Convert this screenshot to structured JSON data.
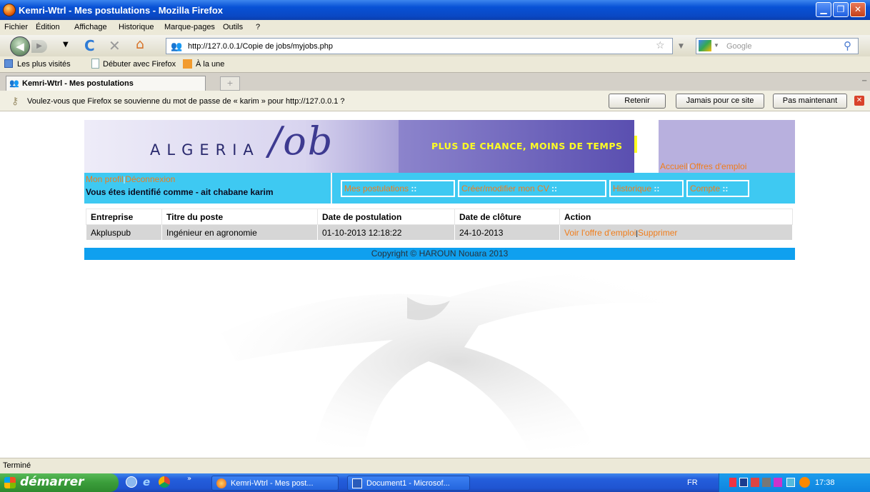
{
  "window": {
    "title": "Kemri-Wtrl - Mes postulations - Mozilla Firefox",
    "icon": "firefox-icon"
  },
  "menu": [
    "Fichier",
    "Édition",
    "Affichage",
    "Historique",
    "Marque-pages",
    "Outils",
    "?"
  ],
  "nav": {
    "url": "http://127.0.0.1/Copie de jobs/myjobs.php",
    "search_placeholder": "Google"
  },
  "bookmarks": [
    "Les plus visités",
    "Débuter avec Firefox",
    "À la une"
  ],
  "tab": {
    "label": "Kemri-Wtrl - Mes postulations",
    "new_tab": "+"
  },
  "notification": {
    "message": "Voulez-vous que Firefox se souvienne du mot de passe de « karim » pour http://127.0.0.1 ?",
    "buttons": [
      "Retenir",
      "Jamais pour ce site",
      "Pas maintenant"
    ]
  },
  "site": {
    "logo_word": "ALGERIA",
    "slogan": "PLUS DE CHANCE, MOINS DE TEMPS",
    "header_links": [
      "Accueil",
      "Offres d'emploi"
    ],
    "user_links": [
      "Mon profil",
      "Déconnexion"
    ],
    "identity": "Vous étes identifié comme - ait chabane karim",
    "tabs": [
      "Mes postulations",
      "Créer/modifier mon CV",
      "Historique",
      "Compte"
    ],
    "tab_suffix": "::",
    "link_sep": "|"
  },
  "table": {
    "columns": [
      "Entreprise",
      "Titre du poste",
      "Date de postulation",
      "Date de clôture",
      "Action"
    ],
    "rows": [
      {
        "entreprise": "Akpluspub",
        "titre": "Ingénieur en agronomie",
        "date_postulation": "01-10-2013 12:18:22",
        "date_cloture": "24-10-2013",
        "actions": [
          "Voir l'offre d'emploi",
          "Supprimer"
        ]
      }
    ]
  },
  "footer": "Copyright © HAROUN Nouara 2013",
  "status": "Terminé",
  "taskbar": {
    "start": "démarrer",
    "windows": [
      "Kemri-Wtrl - Mes post...",
      "Document1 - Microsof..."
    ],
    "lang": "FR",
    "time": "17:38"
  },
  "colors": {
    "site_cyan": "#3ec9f2",
    "link_orange": "#f07d1b",
    "footer_blue": "#0fa0ef",
    "slogan_yellow": "#ffff22"
  }
}
